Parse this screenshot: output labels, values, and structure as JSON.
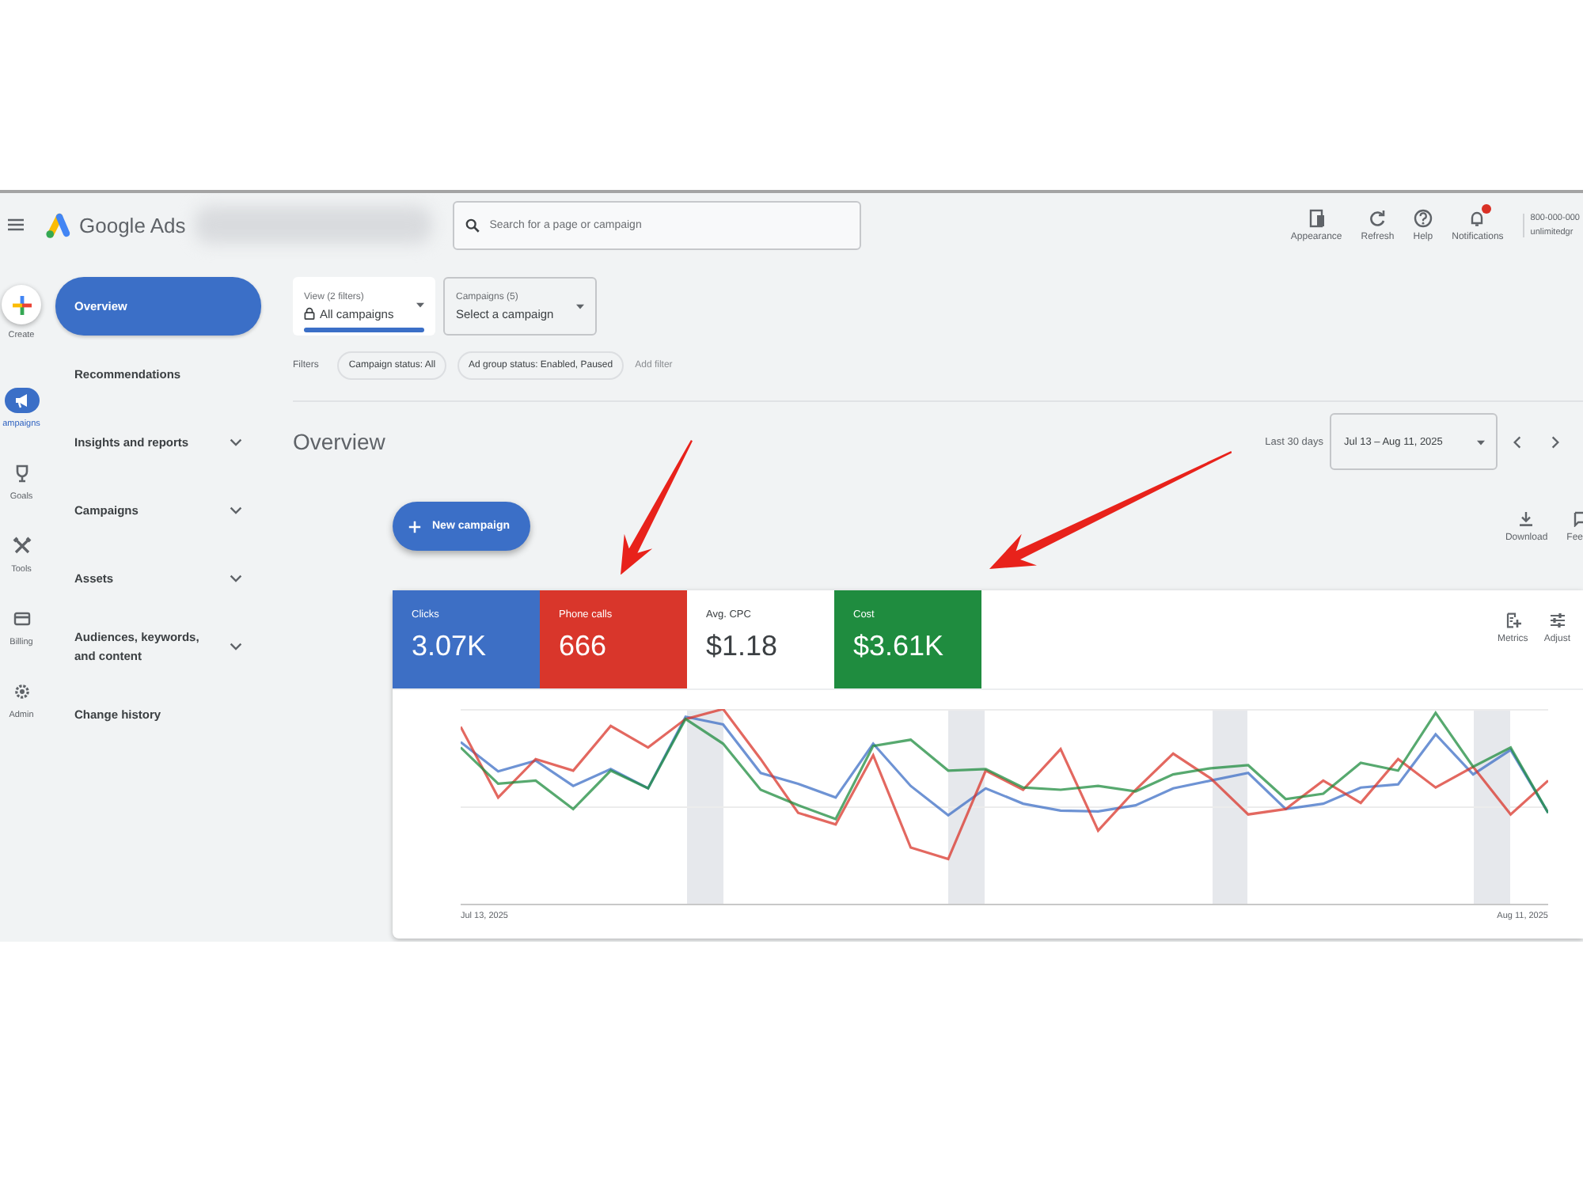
{
  "topbar": {
    "product": "Google Ads",
    "search": {
      "placeholder": "Search for a page or campaign"
    },
    "actions": [
      {
        "kind": "appearance",
        "label": "Appearance"
      },
      {
        "kind": "refresh",
        "label": "Refresh"
      },
      {
        "kind": "help",
        "label": "Help"
      },
      {
        "kind": "notifications",
        "label": "Notifications",
        "badge": true
      }
    ],
    "account": [
      "800-000-000",
      "unlimitedgr"
    ]
  },
  "rail": [
    {
      "kind": "create",
      "label": "Create",
      "selected": false
    },
    {
      "kind": "campaigns",
      "label": "ampaigns",
      "selected": true
    },
    {
      "kind": "goals",
      "label": "Goals",
      "selected": false
    },
    {
      "kind": "tools",
      "label": "Tools",
      "selected": false
    },
    {
      "kind": "billing",
      "label": "Billing",
      "selected": false
    },
    {
      "kind": "admin",
      "label": "Admin",
      "selected": false
    }
  ],
  "nav": [
    {
      "label": "Overview",
      "kind": "page",
      "selected": true
    },
    {
      "label": "Recommendations",
      "kind": "page",
      "selected": false
    },
    {
      "label": "Insights and reports",
      "kind": "group",
      "selected": false
    },
    {
      "label": "Campaigns",
      "kind": "group",
      "selected": false
    },
    {
      "label": "Assets",
      "kind": "group",
      "selected": false
    },
    {
      "label": "Audiences, keywords, and content",
      "kind": "group",
      "selected": false
    },
    {
      "label": "Change history",
      "kind": "page",
      "selected": false
    }
  ],
  "view_select": {
    "label": "View (2 filters)",
    "value": "All campaigns"
  },
  "campaign_select": {
    "label": "Campaigns (5)",
    "value": "Select a campaign"
  },
  "filters": {
    "label": "Filters",
    "chips": [
      "Campaign status: All",
      "Ad group status: Enabled, Paused"
    ],
    "add": "Add filter"
  },
  "overview": {
    "title": "Overview",
    "range_label": "Last 30 days",
    "date_range": "Jul 13 – Aug 11, 2025"
  },
  "new_campaign": "New campaign",
  "tools": [
    {
      "kind": "download",
      "label": "Download"
    },
    {
      "kind": "feedback",
      "label": "Fee"
    }
  ],
  "metrics": [
    {
      "label": "Clicks",
      "value": "3.07K",
      "selected": true,
      "color": "#3d6fc5"
    },
    {
      "label": "Phone calls",
      "value": "666",
      "selected": true,
      "color": "#d9362b"
    },
    {
      "label": "Avg. CPC",
      "value": "$1.18",
      "selected": false
    },
    {
      "label": "Cost",
      "value": "$3.61K",
      "selected": true,
      "color": "#1f8c3f"
    }
  ],
  "metric_tools": [
    {
      "kind": "metrics",
      "label": "Metrics"
    },
    {
      "kind": "adjust",
      "label": "Adjust"
    }
  ],
  "chart": {
    "axis_labels": [
      "Jul 13, 2025",
      "Aug 11, 2025"
    ]
  }
}
